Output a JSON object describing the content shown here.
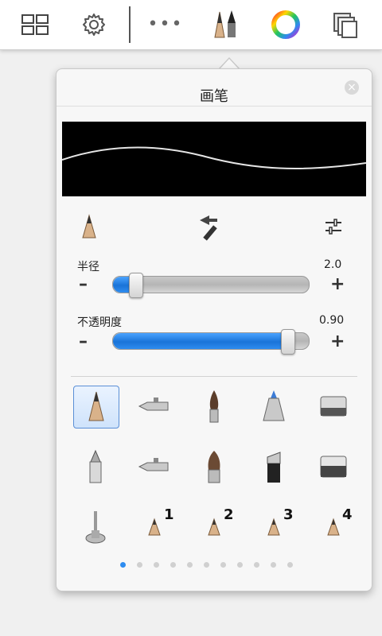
{
  "toolbar": {
    "items": [
      "layout-grid-icon",
      "settings-gear-icon",
      "more-dots-icon",
      "brushes-icon",
      "color-wheel-icon",
      "layers-icon"
    ],
    "more_label": "•••"
  },
  "panel": {
    "title": "画笔",
    "close_glyph": "×"
  },
  "sliders": {
    "radius": {
      "label": "半径",
      "value": "2.0",
      "fraction": 0.12,
      "minus": "–",
      "plus": "+"
    },
    "opacity": {
      "label": "不透明度",
      "value": "0.90",
      "fraction": 0.9,
      "minus": "–",
      "plus": "+"
    }
  },
  "brushes": {
    "row1": [
      "pencil-icon",
      "airbrush-icon",
      "paintbrush-icon",
      "marker-icon",
      "eraser-icon"
    ],
    "row2": [
      "ballpoint-icon",
      "airbrush-soft-icon",
      "flat-brush-icon",
      "chisel-marker-icon",
      "hard-eraser-icon"
    ],
    "row3": [
      "smudge-icon",
      "custom-slot-1-icon",
      "custom-slot-2-icon",
      "custom-slot-3-icon",
      "custom-slot-4-icon"
    ],
    "slot_numbers": [
      "1",
      "2",
      "3",
      "4"
    ],
    "selected": "pencil-icon"
  },
  "pagination": {
    "count": 11,
    "active": 0
  },
  "colors": {
    "accent": "#2e8cf0",
    "preview_bg": "#000000"
  }
}
